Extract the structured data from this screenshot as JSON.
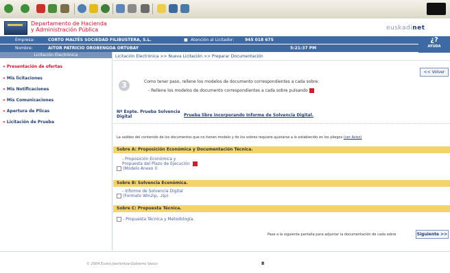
{
  "header": {
    "dept_line1": "Departamento de Hacienda",
    "dept_line2": "y Administración Pública",
    "brand_left": "euskadi",
    "brand_right": "net"
  },
  "infobar": {
    "empresa_label": "Empresa:",
    "empresa_value": "CORTO MALTÉS SOCIEDAD FILIBUSTERA, S.L.",
    "atencion_label": "Atención al Licitador:",
    "atencion_phone": "945 018 675",
    "nombre_label": "Nombre:",
    "nombre_value": "AITOR PATRICIO OROBENGOA ORTUBAY",
    "time": "5:21:37 PM",
    "ayuda_symbol": "¿?",
    "ayuda_label": "AYUDA"
  },
  "sidebar": {
    "title": "Licitación Electrónica",
    "items": [
      {
        "label": "Presentación de ofertas"
      },
      {
        "label": "Mis licitaciones"
      },
      {
        "label": "Mis Notificaciones"
      },
      {
        "label": "Mis Comunicaciones"
      },
      {
        "label": "Apertura de Plicas"
      },
      {
        "label": "Licitación de Prueba"
      }
    ]
  },
  "main": {
    "breadcrumb": "Licitación Electrónica >> Nueva Licitación >> Preparar Documentación",
    "volver": "<< Volver",
    "step": "3",
    "instr1": "Como tener paso, rellene los modelos de documento correspondientes a cada sobre:",
    "instr2": "- Rellene los modelos de documento correspondientes a cada sobre pulsando",
    "exp_label_line1": "Nº Expte. Prueba Solvencia",
    "exp_label_line2": "Digital",
    "exp_value": "Prueba libre incorporando Informe de Solvencia Digital.",
    "validity": "La validez del contenido de los documentos que no tienen modelo y de los sobres requiere ajustarse a lo establecido en los pliegos",
    "validity_link": "(ver Aviso)",
    "sections": [
      {
        "title": "Sobre A: Proposición Económica y Documentación Técnica.",
        "docs": [
          "- Proposición Económica y",
          "Propuesta del Plazo de Ejecución",
          "(Modelo Anexo I)"
        ]
      },
      {
        "title": "Sobre B: Solvencia Económica.",
        "docs": [
          "- Informe de Solvencia Digital",
          "(Formato Win2ip, .zip)"
        ]
      },
      {
        "title": "Sobre C: Propuesta Técnica.",
        "docs": [
          "- Propuesta Técnica y Metodología."
        ]
      }
    ],
    "footer_text": "Pase a la siguiente pantalla para adjuntar la documentación de cada sobre",
    "siguiente": "Siguiente >>"
  },
  "footer": {
    "copyright": "© 2004 Eusko Jaurlaritza-Gobierno Vasco",
    "page_mark": "8"
  },
  "colors": {
    "accent_blue": "#3d69a4",
    "brand_red": "#c8102e",
    "section_yellow": "#f3d36a"
  },
  "icons": [
    "back-icon",
    "forward-icon",
    "stop-icon",
    "refresh-icon",
    "home-icon",
    "search-icon",
    "favorites-icon",
    "history-icon",
    "mail-icon",
    "print-icon",
    "edit-icon",
    "discuss-icon",
    "messenger-icon",
    "pdf-icon",
    "checkbox-icon"
  ]
}
